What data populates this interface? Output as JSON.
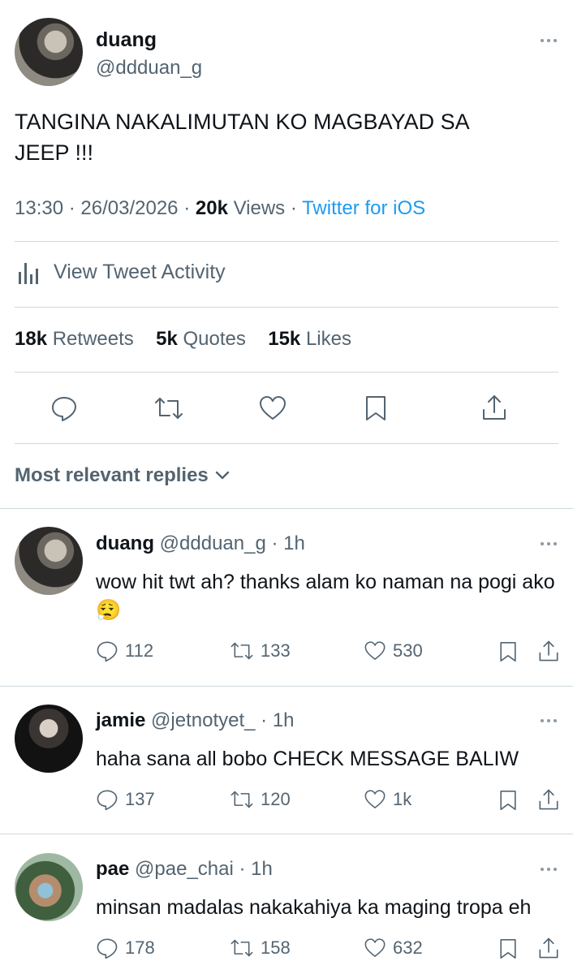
{
  "tweet": {
    "author_name": "duang",
    "author_handle": "@ddduan_g",
    "text": "TANGINA NAKALIMUTAN KO MAGBAYAD SA JEEP !!!",
    "time": "13:30",
    "date": "26/03/2026",
    "sep": "·",
    "views_count": "20k",
    "views_label": "Views",
    "client": "Twitter for iOS",
    "activity_label": "View Tweet Activity",
    "retweets_count": "18k",
    "retweets_label": "Retweets",
    "quotes_count": "5k",
    "quotes_label": "Quotes",
    "likes_count": "15k",
    "likes_label": "Likes"
  },
  "replies_header": "Most relevant replies",
  "replies": [
    {
      "name": "duang",
      "handle": "@ddduan_g",
      "time": "· 1h",
      "text": "wow hit twt ah? thanks alam ko naman na pogi ako 😮‍💨",
      "replies": "112",
      "retweets": "133",
      "likes": "530"
    },
    {
      "name": "jamie",
      "handle": "@jetnotyet_",
      "time": "· 1h",
      "text": "haha sana all bobo CHECK MESSAGE BALIW",
      "replies": "137",
      "retweets": "120",
      "likes": "1k"
    },
    {
      "name": "pae",
      "handle": "@pae_chai",
      "time": "· 1h",
      "text": "minsan madalas nakakahiya ka maging tropa eh",
      "replies": "178",
      "retweets": "158",
      "likes": "632"
    }
  ],
  "colors": {
    "accent": "#1d9bf0",
    "muted": "#536471",
    "divider": "#cfd9de"
  }
}
